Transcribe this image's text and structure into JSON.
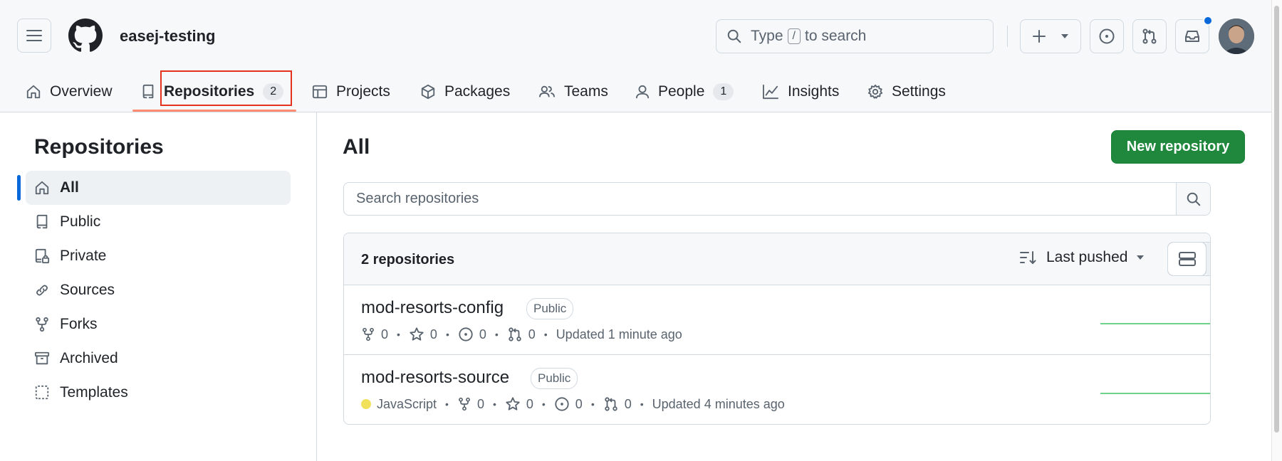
{
  "header": {
    "org_name": "easej-testing",
    "search_prefix": "Type",
    "search_key": "/",
    "search_suffix": "to search"
  },
  "tabs": [
    {
      "label": "Overview",
      "icon": "home-icon"
    },
    {
      "label": "Repositories",
      "icon": "repo-icon",
      "count": "2",
      "active": true
    },
    {
      "label": "Projects",
      "icon": "table-icon"
    },
    {
      "label": "Packages",
      "icon": "package-icon"
    },
    {
      "label": "Teams",
      "icon": "people-icon"
    },
    {
      "label": "People",
      "icon": "person-icon",
      "count": "1"
    },
    {
      "label": "Insights",
      "icon": "graph-icon"
    },
    {
      "label": "Settings",
      "icon": "gear-icon"
    }
  ],
  "sidebar": {
    "title": "Repositories",
    "items": [
      {
        "label": "All",
        "icon": "home-icon",
        "active": true
      },
      {
        "label": "Public",
        "icon": "repo-icon"
      },
      {
        "label": "Private",
        "icon": "lock-repo-icon"
      },
      {
        "label": "Sources",
        "icon": "link-icon"
      },
      {
        "label": "Forks",
        "icon": "fork-icon"
      },
      {
        "label": "Archived",
        "icon": "archive-icon"
      },
      {
        "label": "Templates",
        "icon": "template-icon"
      }
    ]
  },
  "main": {
    "title": "All",
    "new_repo_label": "New repository",
    "search_placeholder": "Search repositories",
    "count_label": "2 repositories",
    "sort_label": "Last pushed"
  },
  "repos": [
    {
      "name": "mod-resorts-config",
      "visibility": "Public",
      "language": "",
      "forks": "0",
      "stars": "0",
      "issues": "0",
      "prs": "0",
      "updated": "Updated 1 minute ago"
    },
    {
      "name": "mod-resorts-source",
      "visibility": "Public",
      "language": "JavaScript",
      "language_color": "#f1e05a",
      "forks": "0",
      "stars": "0",
      "issues": "0",
      "prs": "0",
      "updated": "Updated 4 minutes ago"
    }
  ],
  "colors": {
    "accent_blue": "#0969da",
    "primary_green": "#1f883d",
    "tab_underline": "#fd8c73",
    "highlight_red": "#e5321f"
  }
}
